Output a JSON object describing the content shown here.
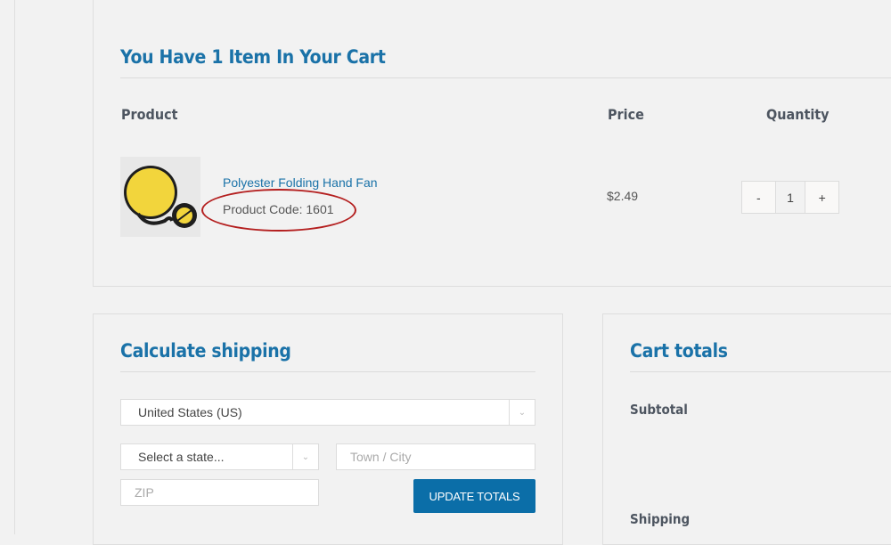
{
  "cart": {
    "heading": "You Have 1 Item In Your Cart",
    "columns": {
      "product": "Product",
      "price": "Price",
      "quantity": "Quantity"
    },
    "items": [
      {
        "name": "Polyester Folding Hand Fan",
        "code_label": "Product Code: 1601",
        "price": "$2.49",
        "quantity": "1",
        "image": "yellow-folding-fan-thumbnail"
      }
    ],
    "qty_minus": "-",
    "qty_plus": "+"
  },
  "shipping": {
    "heading": "Calculate shipping",
    "country_value": "United States (US)",
    "state_value": "Select a state...",
    "city_placeholder": "Town / City",
    "zip_placeholder": "ZIP",
    "update_label": "UPDATE TOTALS",
    "caret_icon": "chevron-down-icon"
  },
  "totals": {
    "heading": "Cart totals",
    "subtotal_label": "Subtotal",
    "shipping_label": "Shipping"
  },
  "colors": {
    "accent": "#1a72a8",
    "button": "#0b6ea8",
    "annotation": "#b41f1f",
    "background": "#f2f2f2"
  }
}
